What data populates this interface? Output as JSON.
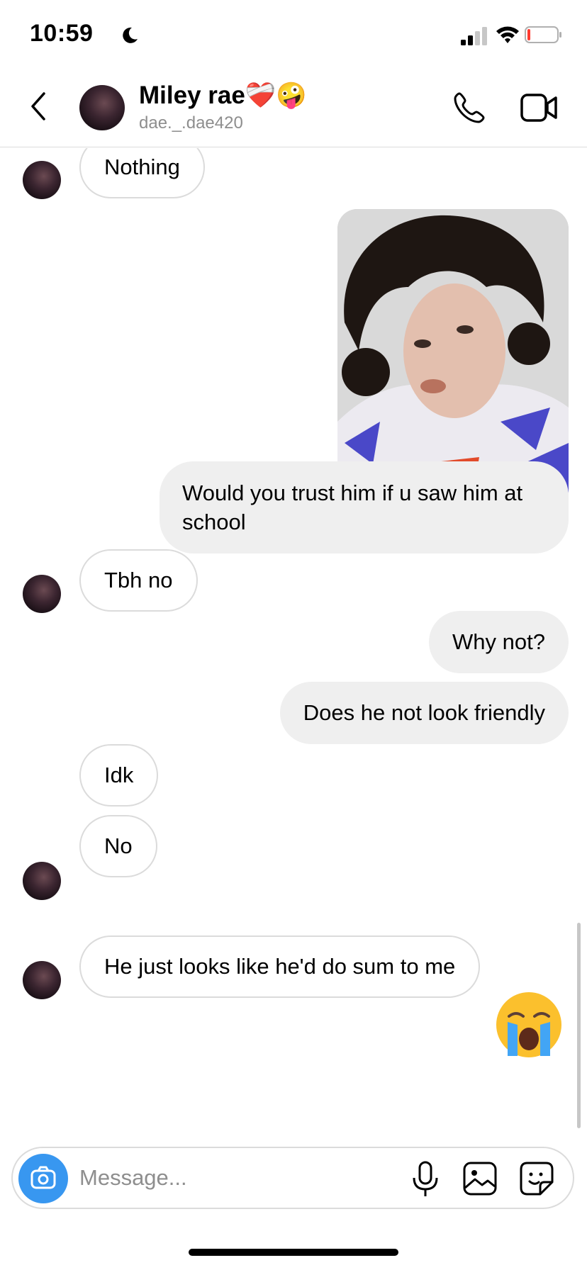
{
  "status_bar": {
    "time": "10:59"
  },
  "header": {
    "contact_name": "Miley rae❤️‍🩹🤪",
    "contact_handle": "dae._.dae420"
  },
  "messages": [
    {
      "from": "them",
      "text": "Nothing"
    },
    {
      "from": "me",
      "type": "photo"
    },
    {
      "from": "me",
      "text": "Would you trust him if u saw him at school"
    },
    {
      "from": "them",
      "text": "Tbh no"
    },
    {
      "from": "me",
      "text": "Why not?"
    },
    {
      "from": "me",
      "text": "Does he not look friendly"
    },
    {
      "from": "them",
      "text": "Idk"
    },
    {
      "from": "them",
      "text": "No"
    },
    {
      "from": "me",
      "type": "emoji",
      "emoji": "😭"
    },
    {
      "from": "them",
      "text": "He just looks like he'd do sum to me"
    }
  ],
  "composer": {
    "placeholder": "Message..."
  },
  "colors": {
    "accent": "#3897f0",
    "outgoing_bubble": "#efefef",
    "border": "#dbdbdb",
    "muted": "#8e8e8e"
  },
  "icons": [
    "moon-icon",
    "signal-icon",
    "wifi-icon",
    "battery-icon",
    "back-icon",
    "phone-icon",
    "video-icon",
    "camera-icon",
    "mic-icon",
    "gallery-icon",
    "sticker-icon"
  ]
}
